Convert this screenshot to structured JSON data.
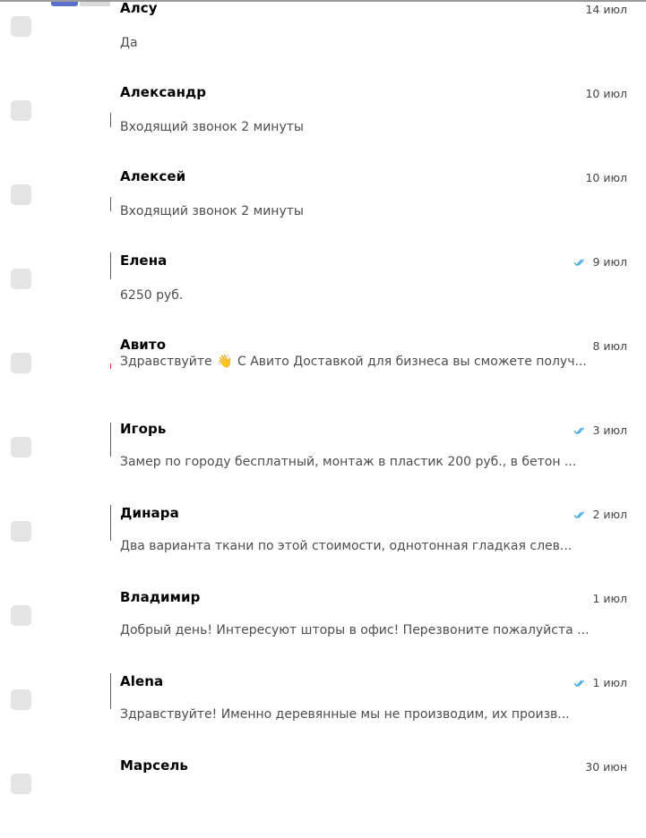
{
  "chats": [
    {
      "name": "Алсу",
      "date": "14 июл",
      "read": false,
      "preview": "Да"
    },
    {
      "name": "Александр",
      "date": "10 июл",
      "read": false,
      "preview": "Входящий звонок 2 минуты"
    },
    {
      "name": "Алексей",
      "date": "10 июл",
      "read": false,
      "preview": "Входящий звонок 2 минуты"
    },
    {
      "name": "Елена",
      "date": "9 июл",
      "read": true,
      "preview": "6250 руб."
    },
    {
      "name": "Авито",
      "date": "8 июл",
      "read": false,
      "preview_before": "Здравствуйте",
      "preview_emoji": "👋",
      "preview_after": "С Авито Доставкой для бизнеса вы сможете получ..."
    },
    {
      "name": "Игорь",
      "date": "3 июл",
      "read": true,
      "preview": "Замер по городу бесплатный, монтаж в пластик 200 руб., в бетон ..."
    },
    {
      "name": "Динара",
      "date": "2 июл",
      "read": true,
      "preview": "Два варианта ткани по этой стоимости, однотонная гладкая слев..."
    },
    {
      "name": "Владимир",
      "date": "1 июл",
      "read": false,
      "preview": "Добрый день! Интересуют шторы в офис! Перезвоните пожалуйста ..."
    },
    {
      "name": "Alena",
      "date": "1 июл",
      "read": true,
      "preview": "Здравствуйте! Именно деревянные мы не производим, их произв..."
    },
    {
      "name": "Марсель",
      "date": "30 июн",
      "read": false,
      "preview": ""
    }
  ],
  "colors": {
    "read_check": "#2fa4e7",
    "checkbox": "#e4e4e4",
    "preview_text": "#4d4d4d"
  },
  "icons": {
    "read": "double-check-icon",
    "checkbox": "checkbox-icon"
  }
}
